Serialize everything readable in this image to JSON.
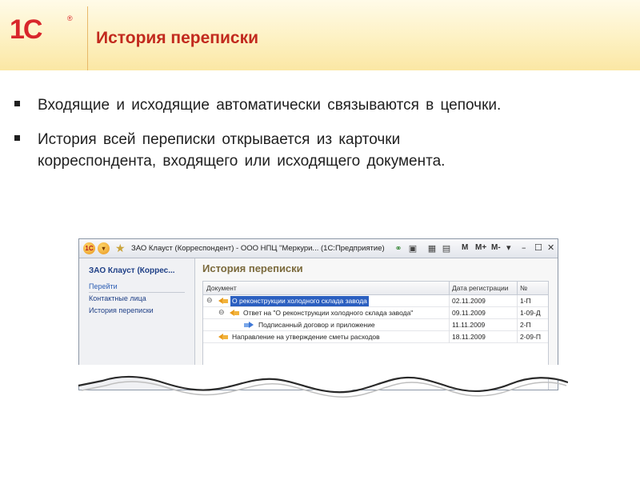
{
  "slide": {
    "logo_text": "1С",
    "logo_reg": "®",
    "title": "История переписки"
  },
  "bullets": [
    "Входящие и исходящие автоматически связываются в цепочки.",
    "История всей переписки открывается из карточки корреспондента, входящего или исходящего документа."
  ],
  "app": {
    "titlebar": {
      "title": "ЗАО Клауст (Корреспондент) - ООО НПЦ \"Меркури... (1С:Предприятие)",
      "m_label": "M",
      "m_plus_label": "M+",
      "m_minus_label": "M-"
    },
    "sidebar": {
      "title": "ЗАО Клауст (Коррес...",
      "section": "Перейти",
      "links": [
        "Контактные лица",
        "История переписки"
      ]
    },
    "pane_title": "История переписки",
    "columns": [
      "Документ",
      "Дата регистрации",
      "№"
    ],
    "rows": [
      {
        "document": "О реконструкции холодного склада завода",
        "date": "02.11.2009",
        "number": "1-П",
        "direction": "incoming",
        "level": 0,
        "toggle": "⊖",
        "selected": true
      },
      {
        "document": "Ответ на \"О реконструкции холодного склада завода\"",
        "date": "09.11.2009",
        "number": "1-09-Д",
        "direction": "outgoing",
        "level": 1,
        "toggle": "⊖",
        "selected": false
      },
      {
        "document": "Подписанный договор и приложение",
        "date": "11.11.2009",
        "number": "2-П",
        "direction": "incoming",
        "level": 2,
        "toggle": "",
        "selected": false
      },
      {
        "document": "Направление на утверждение сметы расходов",
        "date": "18.11.2009",
        "number": "2-09-П",
        "direction": "outgoing",
        "level": 0,
        "toggle": "",
        "selected": false
      }
    ]
  },
  "colors": {
    "title_red": "#c22a1e",
    "header_yellow": "#fbe7a4",
    "selection_blue": "#2b5fc0",
    "incoming_orange": "#e89a1b",
    "outgoing_blue": "#3f78d6"
  }
}
